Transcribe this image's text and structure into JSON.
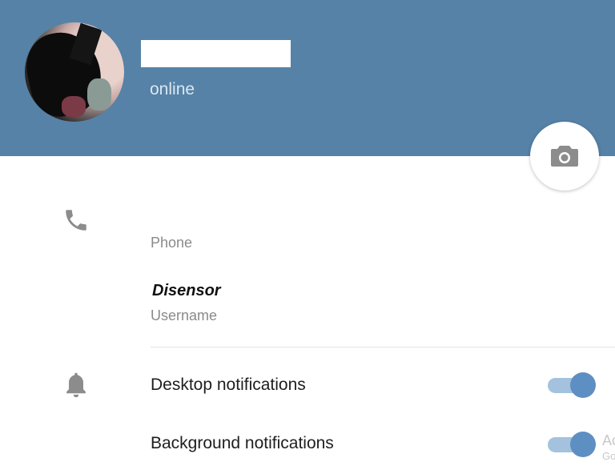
{
  "header": {
    "status": "online",
    "background_color": "#5682a7",
    "camera_button_icon": "camera-icon"
  },
  "info": {
    "phone_label": "Phone",
    "username_value": "Disensor",
    "username_label": "Username"
  },
  "notifications": [
    {
      "label": "Desktop notifications",
      "enabled": true
    },
    {
      "label": "Background notifications",
      "enabled": true
    }
  ],
  "edge_text": {
    "line1": "Ac",
    "line2": "Go"
  },
  "colors": {
    "accent": "#5e8fc2",
    "toggle_track": "#a4c2dd",
    "icon_gray": "#8c8c8c"
  }
}
